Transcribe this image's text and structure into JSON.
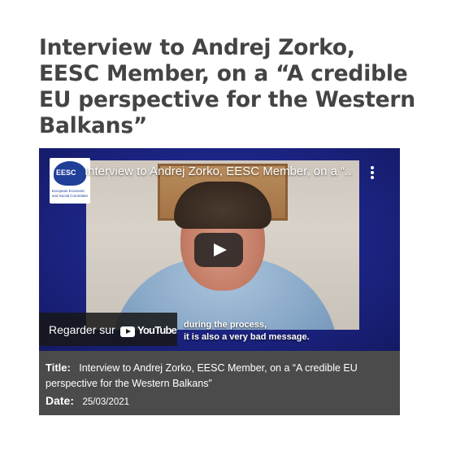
{
  "article": {
    "title": "Interview to Andrej Zorko, EESC Member, on a “A credible EU perspective for the Western Balkans”"
  },
  "player": {
    "video_title": "Interview to Andrej Zorko, EESC Member, on a “...",
    "channel_logo_text": "EESC",
    "channel_logo_subtext": "European Economic and Social Committee",
    "watch_on_label": "Regarder sur",
    "youtube_wordmark": "YouTube",
    "subtitle_line1": "during the process,",
    "subtitle_line2": "it is also a very bad message.",
    "icons": [
      "more-vertical-icon",
      "play-icon",
      "youtube-logo-icon"
    ]
  },
  "meta": {
    "title_label": "Title:",
    "title_value": "Interview to Andrej Zorko, EESC Member, on a “A credible EU perspective for the Western Balkans”",
    "date_label": "Date:",
    "date_value": "25/03/2021"
  },
  "colors": {
    "player_background": "#1c2484",
    "info_panel_background": "#4b4b4b",
    "heading_text": "#444444"
  }
}
